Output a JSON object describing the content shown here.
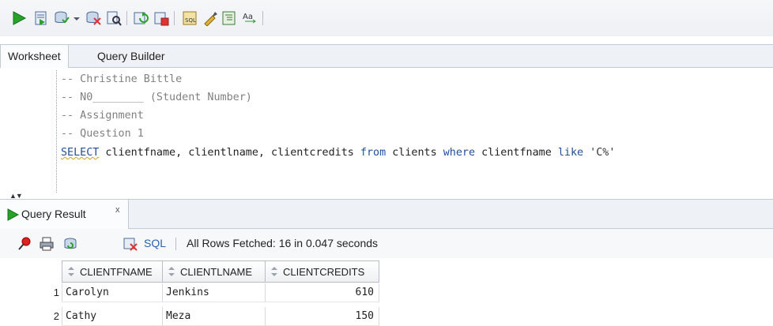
{
  "toolbar": {
    "icons": [
      "run-statement-icon",
      "run-script-icon",
      "commit-icon",
      "dropdown-arrow-icon",
      "rollback-icon",
      "explain-plan-icon",
      "autotrace-icon",
      "sql-tuning-icon",
      "sql-history-icon",
      "clear-icon",
      "format-icon",
      "to-upper-lower-icon"
    ]
  },
  "tabs": {
    "worksheet": "Worksheet",
    "query_builder": "Query Builder"
  },
  "editor": {
    "line1": "-- Christine Bittle",
    "line2": "-- N0________ (Student Number)",
    "line3": "-- Assignment",
    "line4": "-- Question 1",
    "sql": {
      "kw_select": "SELECT",
      "cols": " clientfname, clientlname, clientcredits ",
      "kw_from": "from",
      "table": " clients ",
      "kw_where": "where",
      "col": " clientfname ",
      "kw_like": "like",
      "literal": " 'C%'"
    }
  },
  "result": {
    "tab_label": "Query Result",
    "close_label": "x",
    "sql_label": "SQL",
    "status": "All Rows Fetched: 16 in 0.047 seconds"
  },
  "grid": {
    "columns": [
      "CLIENTFNAME",
      "CLIENTLNAME",
      "CLIENTCREDITS"
    ],
    "rows": [
      {
        "n": "1",
        "fname": "Carolyn",
        "lname": "Jenkins",
        "credits": "610"
      },
      {
        "n": "2",
        "fname": "Cathy",
        "lname": "Meza",
        "credits": "150"
      }
    ]
  },
  "colors": {
    "keyword": "#20509a",
    "comment": "#808080",
    "run_green": "#2aa22a"
  }
}
